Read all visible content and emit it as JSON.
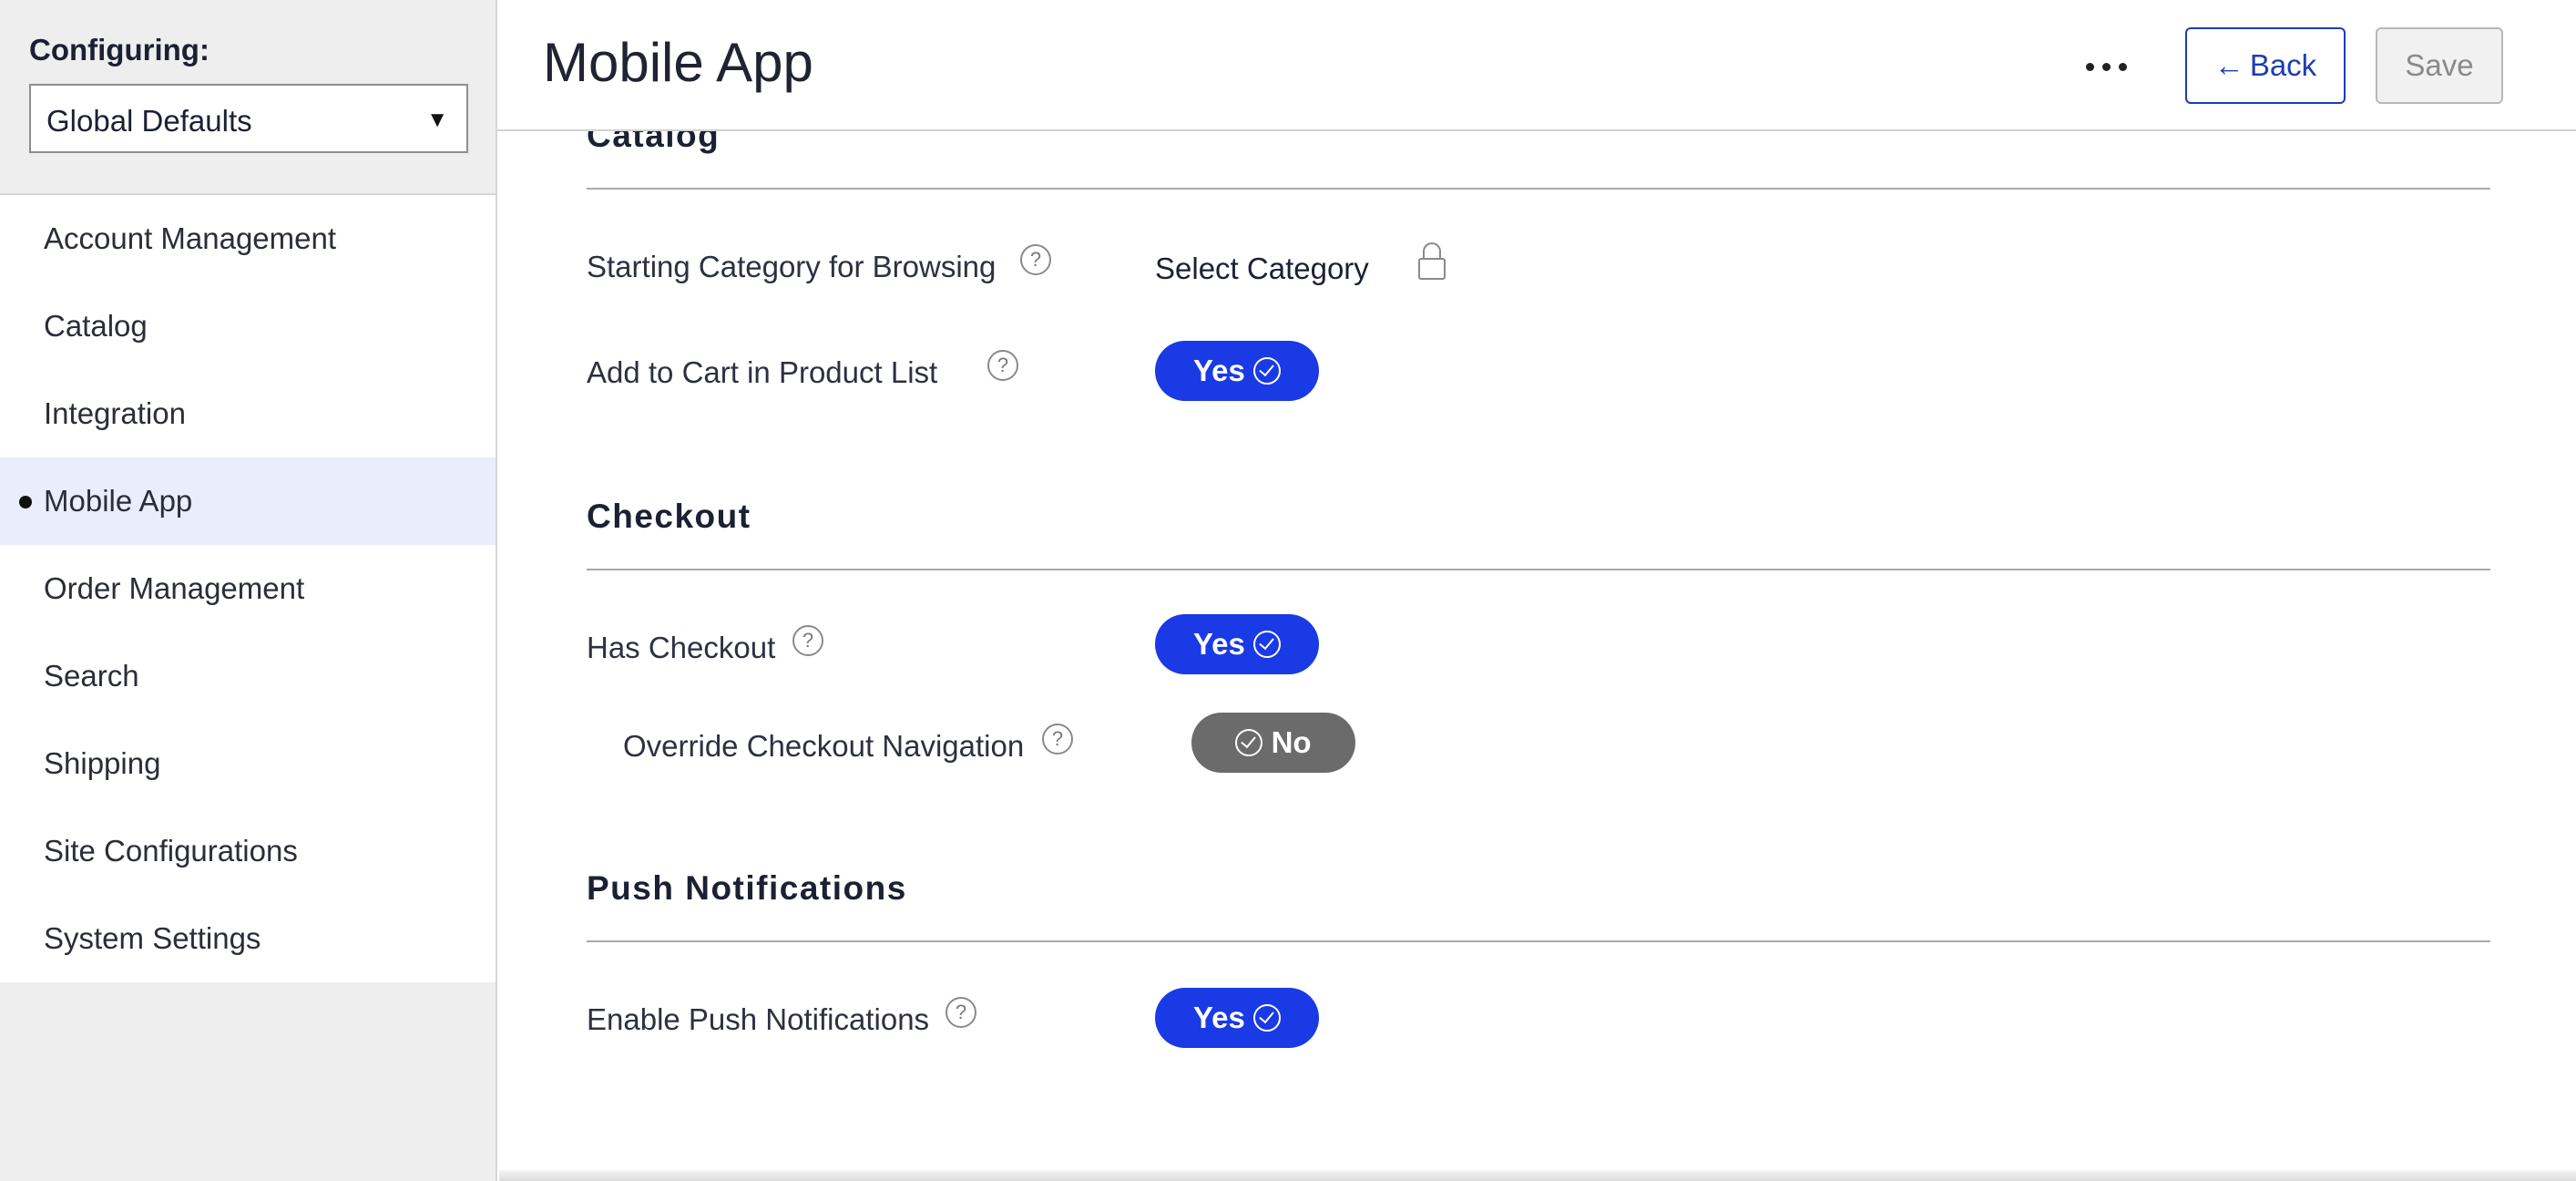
{
  "sidebar": {
    "configuring_label": "Configuring:",
    "scope_select": {
      "value": "Global Defaults"
    },
    "items": [
      {
        "label": "Account Management",
        "active": false
      },
      {
        "label": "Catalog",
        "active": false
      },
      {
        "label": "Integration",
        "active": false
      },
      {
        "label": "Mobile App",
        "active": true
      },
      {
        "label": "Order Management",
        "active": false
      },
      {
        "label": "Search",
        "active": false
      },
      {
        "label": "Shipping",
        "active": false
      },
      {
        "label": "Site Configurations",
        "active": false
      },
      {
        "label": "System Settings",
        "active": false
      }
    ]
  },
  "header": {
    "title": "Mobile App",
    "back_label": "Back",
    "save_label": "Save"
  },
  "sections": {
    "catalog": {
      "title": "Catalog",
      "starting_category": {
        "label": "Starting Category for Browsing",
        "value": "Select Category",
        "locked": true
      },
      "add_to_cart": {
        "label": "Add to Cart in Product List",
        "value": "Yes"
      }
    },
    "checkout": {
      "title": "Checkout",
      "has_checkout": {
        "label": "Has Checkout",
        "value": "Yes"
      },
      "override_nav": {
        "label": "Override Checkout Navigation",
        "value": "No"
      }
    },
    "push": {
      "title": "Push Notifications",
      "enable_push": {
        "label": "Enable Push Notifications",
        "value": "Yes"
      }
    }
  },
  "colors": {
    "toggle_on": "#1a3ae6",
    "toggle_off": "#6b6b6b",
    "accent": "#1d3db5",
    "active_nav_bg": "#eaedfb"
  },
  "icons": {
    "help": "question-circle-icon",
    "lock": "lock-icon",
    "more": "ellipsis-icon",
    "back": "arrow-left-icon",
    "check": "check-circle-icon"
  }
}
